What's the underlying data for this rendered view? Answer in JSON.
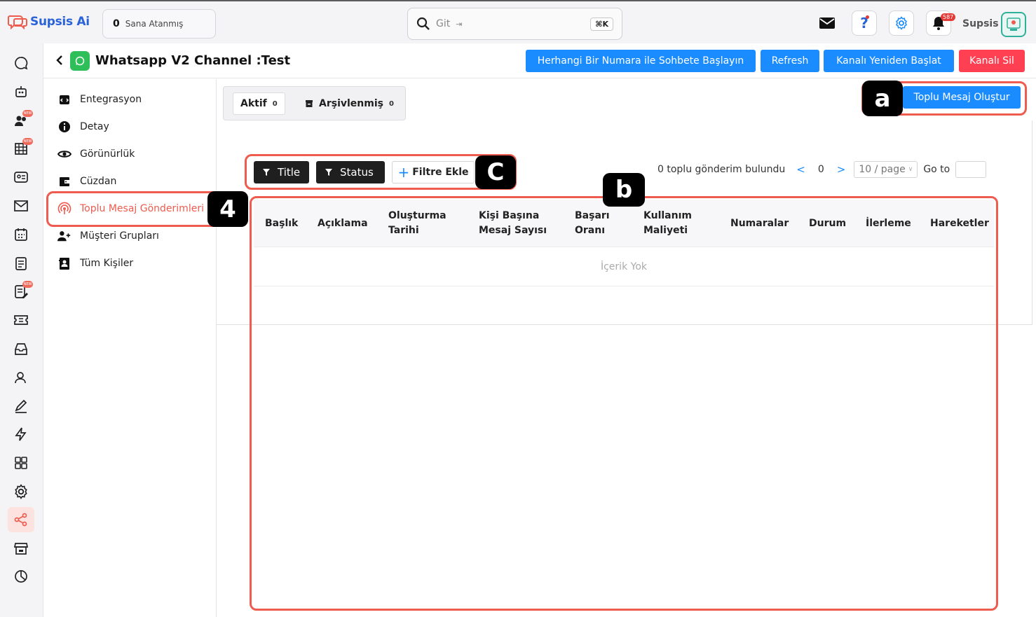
{
  "topbar": {
    "brand": "Supsis Ai",
    "assigned_count": "0",
    "assigned_label": "Sana Atanmış",
    "search_placeholder": "Git",
    "search_shortcut": "⌘K",
    "notification_count": "587",
    "username": "Supsis"
  },
  "header": {
    "title": "Whatsapp V2 Channel :Test",
    "buttons": {
      "start_chat": "Herhangi Bir Numara ile Sohbete Başlayın",
      "refresh": "Refresh",
      "restart": "Kanalı Yeniden Başlat",
      "delete": "Kanalı Sil"
    }
  },
  "rail": {
    "icons": [
      "chat-icon",
      "bot-icon",
      "team-icon",
      "calendar-grid-icon",
      "contact-card-icon",
      "mail-icon",
      "calendar-icon",
      "document-list-icon",
      "edit-list-icon",
      "ticket-icon",
      "inbox-icon",
      "user-icon",
      "pen-icon",
      "flash-icon",
      "apps-icon",
      "settings-icon",
      "share-icon",
      "store-icon",
      "chart-icon"
    ],
    "active": "share-icon"
  },
  "subnav": {
    "items": [
      {
        "label": "Entegrasyon",
        "icon": "integration-icon"
      },
      {
        "label": "Detay",
        "icon": "info-icon"
      },
      {
        "label": "Görünürlük",
        "icon": "eye-icon"
      },
      {
        "label": "Cüzdan",
        "icon": "wallet-icon"
      },
      {
        "label": "Toplu Mesaj Gönderimleri",
        "icon": "broadcast-icon"
      },
      {
        "label": "Müşteri Grupları",
        "icon": "users-add-icon"
      },
      {
        "label": "Tüm Kişiler",
        "icon": "contacts-icon"
      }
    ],
    "active_index": 4
  },
  "tabs": {
    "active": {
      "label": "Aktif",
      "count": "0"
    },
    "archived": {
      "label": "Arşivlenmiş",
      "count": "0"
    }
  },
  "create_button": "Toplu Mesaj Oluştur",
  "filters": {
    "title": "Title",
    "status": "Status",
    "add": "Filtre Ekle"
  },
  "pagination": {
    "summary": "0 toplu gönderim bulundu",
    "page": "0",
    "page_size": "10 / page",
    "goto": "Go to"
  },
  "table": {
    "columns": [
      "Başlık",
      "Açıklama",
      "Oluşturma\nTarihi",
      "Kişi Başına\nMesaj Sayısı",
      "Başarı\nOranı",
      "Kullanım\nMaliyeti",
      "Numaralar",
      "Durum",
      "İlerleme",
      "Hareketler"
    ],
    "empty_text": "İçerik Yok"
  },
  "annotations": {
    "a": "a",
    "b": "b",
    "c": "C",
    "four": "4"
  },
  "colors": {
    "primary_blue": "#1a8cff",
    "danger_red": "#ff4052",
    "highlight": "#ee5c50",
    "whatsapp_green": "#2fbf5a"
  }
}
